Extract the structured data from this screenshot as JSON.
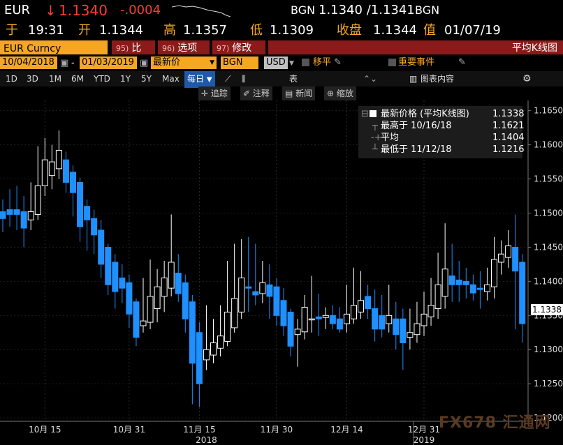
{
  "quote": {
    "ticker": "EUR",
    "arrow": "↓",
    "price": "1.1340",
    "change": "-.0004",
    "source": "BGN",
    "bid_ask": "1.1340 /1.1341",
    "source2": "BGN"
  },
  "stats": {
    "time_label": "于",
    "time": "19:31",
    "open_label": "开",
    "open": "1.1344",
    "high_label": "高",
    "high": "1.1357",
    "low_label": "低",
    "low": "1.1309",
    "close_label": "收盘",
    "close": "1.1344",
    "date_label": "值",
    "date": "01/07/19"
  },
  "toolbar": {
    "security": "EUR Curncy",
    "compare_num": "95)",
    "compare": "比较",
    "options_num": "96)",
    "options": "选项",
    "edit_num": "97)",
    "edit": "修改",
    "chart_title": "平均K线图"
  },
  "daterow": {
    "start": "10/04/2018",
    "dash": "-",
    "end": "01/03/2019",
    "price_type": "最新价",
    "source": "BGN",
    "currency": "USD",
    "move": "移平",
    "events": "重要事件"
  },
  "periods": [
    "1D",
    "3D",
    "1M",
    "6M",
    "YTD",
    "1Y",
    "5Y",
    "Max"
  ],
  "frequency": "每日",
  "table_label": "表",
  "chart_content": "图表内容",
  "subtools": {
    "track": "追踪",
    "annotate": "注释",
    "news": "新闻",
    "zoom": "缩放"
  },
  "legend": {
    "title": "最新价格 (平均K线图)",
    "title_val": "1.1338",
    "high_label": "最高于 10/16/18",
    "high_val": "1.1621",
    "avg_label": "平均",
    "avg_val": "1.1404",
    "low_label": "最低于 11/12/18",
    "low_val": "1.1216"
  },
  "last_price_tag": "1.1338",
  "watermark": "FX678 汇通网",
  "chart_data": {
    "type": "heikin-ashi candlestick",
    "ylim": [
      1.1195,
      1.1665
    ],
    "yticks": [
      "1.1650",
      "1.1600",
      "1.1550",
      "1.1500",
      "1.1450",
      "1.1400",
      "1.1350",
      "1.1300",
      "1.1250",
      "1.1200"
    ],
    "yticks_values": [
      1.165,
      1.16,
      1.155,
      1.15,
      1.145,
      1.14,
      1.135,
      1.13,
      1.125,
      1.12
    ],
    "xticks": [
      {
        "i": 6,
        "label": "10月 15"
      },
      {
        "i": 18,
        "label": "10月 31"
      },
      {
        "i": 28,
        "label": "11月 15"
      },
      {
        "i": 39,
        "label": "11月 30"
      },
      {
        "i": 49,
        "label": "12月 14"
      },
      {
        "i": 60,
        "label": "12月 31"
      }
    ],
    "year_labels": [
      {
        "i": 29,
        "label": "2018"
      },
      {
        "i": 60,
        "label": "2019"
      }
    ],
    "up_color": "#ffffff",
    "down_color": "#1e90ff",
    "candles": [
      {
        "o": 1.1502,
        "c": 1.1492,
        "h": 1.152,
        "l": 1.1472
      },
      {
        "o": 1.1505,
        "c": 1.1498,
        "h": 1.1535,
        "l": 1.148
      },
      {
        "o": 1.1505,
        "c": 1.1498,
        "h": 1.154,
        "l": 1.1475
      },
      {
        "o": 1.1502,
        "c": 1.1478,
        "h": 1.1525,
        "l": 1.145
      },
      {
        "o": 1.149,
        "c": 1.1502,
        "h": 1.1545,
        "l": 1.1475
      },
      {
        "o": 1.1498,
        "c": 1.154,
        "h": 1.1598,
        "l": 1.149
      },
      {
        "o": 1.154,
        "c": 1.1578,
        "h": 1.161,
        "l": 1.1525
      },
      {
        "o": 1.1555,
        "c": 1.1575,
        "h": 1.16,
        "l": 1.1535
      },
      {
        "o": 1.1565,
        "c": 1.1592,
        "h": 1.1621,
        "l": 1.155
      },
      {
        "o": 1.1578,
        "c": 1.1545,
        "h": 1.159,
        "l": 1.153
      },
      {
        "o": 1.156,
        "c": 1.153,
        "h": 1.157,
        "l": 1.1495
      },
      {
        "o": 1.1545,
        "c": 1.148,
        "h": 1.1552,
        "l": 1.1458
      },
      {
        "o": 1.151,
        "c": 1.149,
        "h": 1.152,
        "l": 1.1445
      },
      {
        "o": 1.1492,
        "c": 1.1468,
        "h": 1.1505,
        "l": 1.144
      },
      {
        "o": 1.1475,
        "c": 1.1425,
        "h": 1.149,
        "l": 1.1405
      },
      {
        "o": 1.145,
        "c": 1.1395,
        "h": 1.1455,
        "l": 1.138
      },
      {
        "o": 1.1428,
        "c": 1.1385,
        "h": 1.144,
        "l": 1.136
      },
      {
        "o": 1.1405,
        "c": 1.139,
        "h": 1.1425,
        "l": 1.1368
      },
      {
        "o": 1.1398,
        "c": 1.1352,
        "h": 1.141,
        "l": 1.1332
      },
      {
        "o": 1.137,
        "c": 1.1318,
        "h": 1.1375,
        "l": 1.1305
      },
      {
        "o": 1.1335,
        "c": 1.1342,
        "h": 1.1405,
        "l": 1.1325
      },
      {
        "o": 1.134,
        "c": 1.1378,
        "h": 1.1432,
        "l": 1.133
      },
      {
        "o": 1.136,
        "c": 1.1392,
        "h": 1.1418,
        "l": 1.134
      },
      {
        "o": 1.1378,
        "c": 1.1405,
        "h": 1.143,
        "l": 1.1355
      },
      {
        "o": 1.139,
        "c": 1.1428,
        "h": 1.1498,
        "l": 1.1378
      },
      {
        "o": 1.1412,
        "c": 1.1382,
        "h": 1.144,
        "l": 1.137
      },
      {
        "o": 1.1398,
        "c": 1.1345,
        "h": 1.141,
        "l": 1.1325
      },
      {
        "o": 1.137,
        "c": 1.128,
        "h": 1.138,
        "l": 1.122
      },
      {
        "o": 1.1325,
        "c": 1.125,
        "h": 1.134,
        "l": 1.1216
      },
      {
        "o": 1.1285,
        "c": 1.13,
        "h": 1.1365,
        "l": 1.127
      },
      {
        "o": 1.1292,
        "c": 1.131,
        "h": 1.1345,
        "l": 1.128
      },
      {
        "o": 1.1302,
        "c": 1.132,
        "h": 1.1365,
        "l": 1.129
      },
      {
        "o": 1.1312,
        "c": 1.1355,
        "h": 1.143,
        "l": 1.1305
      },
      {
        "o": 1.1332,
        "c": 1.1375,
        "h": 1.1455,
        "l": 1.1325
      },
      {
        "o": 1.1355,
        "c": 1.1405,
        "h": 1.1462,
        "l": 1.1345
      },
      {
        "o": 1.1392,
        "c": 1.139,
        "h": 1.1465,
        "l": 1.1355
      },
      {
        "o": 1.1385,
        "c": 1.138,
        "h": 1.1455,
        "l": 1.1365
      },
      {
        "o": 1.1382,
        "c": 1.1398,
        "h": 1.143,
        "l": 1.1368
      },
      {
        "o": 1.1395,
        "c": 1.1378,
        "h": 1.1425,
        "l": 1.1345
      },
      {
        "o": 1.1392,
        "c": 1.135,
        "h": 1.1405,
        "l": 1.1335
      },
      {
        "o": 1.1372,
        "c": 1.1335,
        "h": 1.139,
        "l": 1.132
      },
      {
        "o": 1.1355,
        "c": 1.1305,
        "h": 1.136,
        "l": 1.129
      },
      {
        "o": 1.1322,
        "c": 1.133,
        "h": 1.1345,
        "l": 1.1275
      },
      {
        "o": 1.1326,
        "c": 1.1362,
        "h": 1.138,
        "l": 1.1315
      },
      {
        "o": 1.1345,
        "c": 1.1345,
        "h": 1.1408,
        "l": 1.1325
      },
      {
        "o": 1.1348,
        "c": 1.1345,
        "h": 1.1382,
        "l": 1.132
      },
      {
        "o": 1.1347,
        "c": 1.135,
        "h": 1.1362,
        "l": 1.133
      },
      {
        "o": 1.135,
        "c": 1.1338,
        "h": 1.1365,
        "l": 1.133
      },
      {
        "o": 1.1345,
        "c": 1.133,
        "h": 1.1362,
        "l": 1.1325
      },
      {
        "o": 1.1338,
        "c": 1.1352,
        "h": 1.1395,
        "l": 1.1325
      },
      {
        "o": 1.1345,
        "c": 1.1365,
        "h": 1.142,
        "l": 1.1338
      },
      {
        "o": 1.1355,
        "c": 1.1372,
        "h": 1.1415,
        "l": 1.1345
      },
      {
        "o": 1.1378,
        "c": 1.136,
        "h": 1.1395,
        "l": 1.1345
      },
      {
        "o": 1.136,
        "c": 1.133,
        "h": 1.1388,
        "l": 1.1312
      },
      {
        "o": 1.135,
        "c": 1.133,
        "h": 1.138,
        "l": 1.1318
      },
      {
        "o": 1.1338,
        "c": 1.135,
        "h": 1.1395,
        "l": 1.1325
      },
      {
        "o": 1.1345,
        "c": 1.1322,
        "h": 1.137,
        "l": 1.13
      },
      {
        "o": 1.1345,
        "c": 1.131,
        "h": 1.136,
        "l": 1.127
      },
      {
        "o": 1.1318,
        "c": 1.1325,
        "h": 1.136,
        "l": 1.13
      },
      {
        "o": 1.1322,
        "c": 1.1338,
        "h": 1.137,
        "l": 1.131
      },
      {
        "o": 1.1335,
        "c": 1.1352,
        "h": 1.1385,
        "l": 1.132
      },
      {
        "o": 1.1348,
        "c": 1.1365,
        "h": 1.1405,
        "l": 1.1335
      },
      {
        "o": 1.136,
        "c": 1.1395,
        "h": 1.1442,
        "l": 1.1345
      },
      {
        "o": 1.1378,
        "c": 1.1418,
        "h": 1.1485,
        "l": 1.136
      },
      {
        "o": 1.1408,
        "c": 1.1395,
        "h": 1.1455,
        "l": 1.137
      },
      {
        "o": 1.1402,
        "c": 1.1395,
        "h": 1.143,
        "l": 1.137
      },
      {
        "o": 1.14,
        "c": 1.1395,
        "h": 1.142,
        "l": 1.1375
      },
      {
        "o": 1.1395,
        "c": 1.1383,
        "h": 1.141,
        "l": 1.1372
      },
      {
        "o": 1.139,
        "c": 1.1388,
        "h": 1.1415,
        "l": 1.136
      },
      {
        "o": 1.1385,
        "c": 1.1395,
        "h": 1.142,
        "l": 1.1372
      },
      {
        "o": 1.1392,
        "c": 1.1432,
        "h": 1.1465,
        "l": 1.1375
      },
      {
        "o": 1.1428,
        "c": 1.144,
        "h": 1.146,
        "l": 1.141
      },
      {
        "o": 1.1435,
        "c": 1.1452,
        "h": 1.1475,
        "l": 1.142
      },
      {
        "o": 1.145,
        "c": 1.1415,
        "h": 1.1498,
        "l": 1.133
      },
      {
        "o": 1.1428,
        "c": 1.1338,
        "h": 1.144,
        "l": 1.131
      }
    ]
  }
}
